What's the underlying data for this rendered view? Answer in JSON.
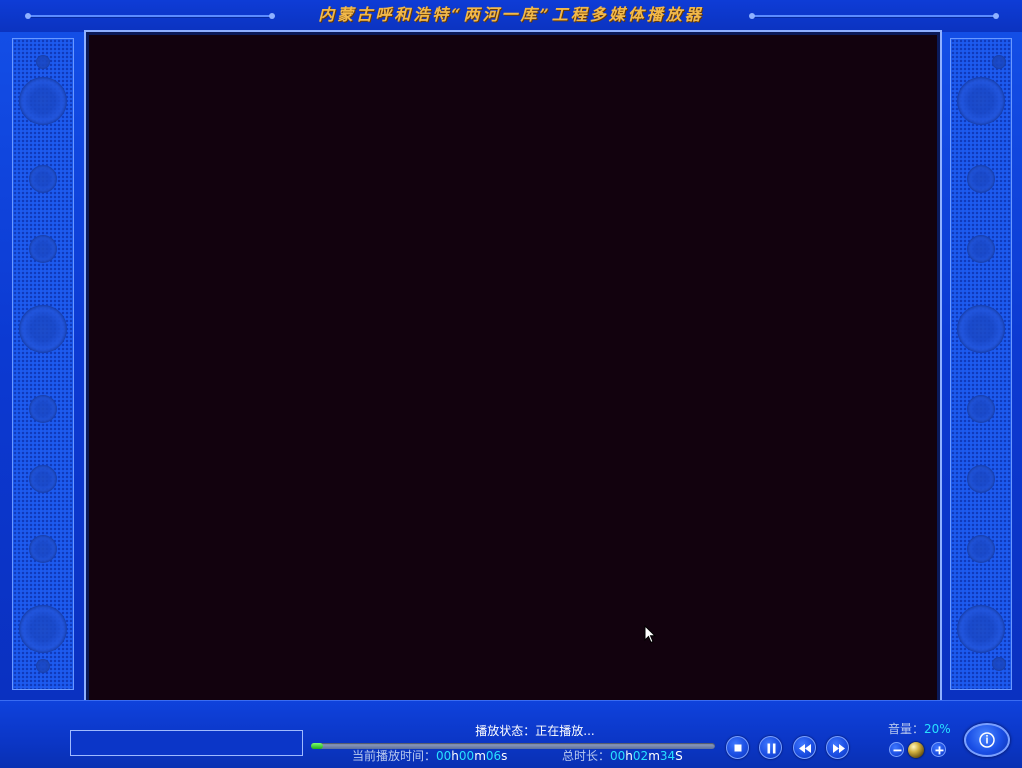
{
  "window": {
    "title": "内蒙古呼和浩特“两河一库”工程多媒体播放器"
  },
  "player": {
    "status_label": "播放状态：",
    "status_value": "正在播放...",
    "progress": 0.03,
    "info_box_text": "",
    "current_time": {
      "label": "当前播放时间：",
      "hours": "00",
      "minutes": "00",
      "seconds": "06",
      "h_unit": "h",
      "m_unit": "m",
      "s_unit": "s"
    },
    "total_time": {
      "label": "总时长：",
      "hours": "00",
      "minutes": "02",
      "seconds": "34",
      "h_unit": "h",
      "m_unit": "m",
      "s_unit": "S"
    }
  },
  "controls": {
    "stop": "stop-icon",
    "pause": "pause-icon",
    "rewind": "rewind-icon",
    "forward": "fast-forward-icon"
  },
  "volume": {
    "label": "音量：",
    "value": "20%",
    "level": 0.2
  },
  "info_button": {
    "icon": "info-icon"
  },
  "colors": {
    "background": "#0c3ad2",
    "title_text": "#f2b94a",
    "video": "#12020e",
    "time_digits": "#28e0ff",
    "progress_fill": "#1ea81a"
  }
}
